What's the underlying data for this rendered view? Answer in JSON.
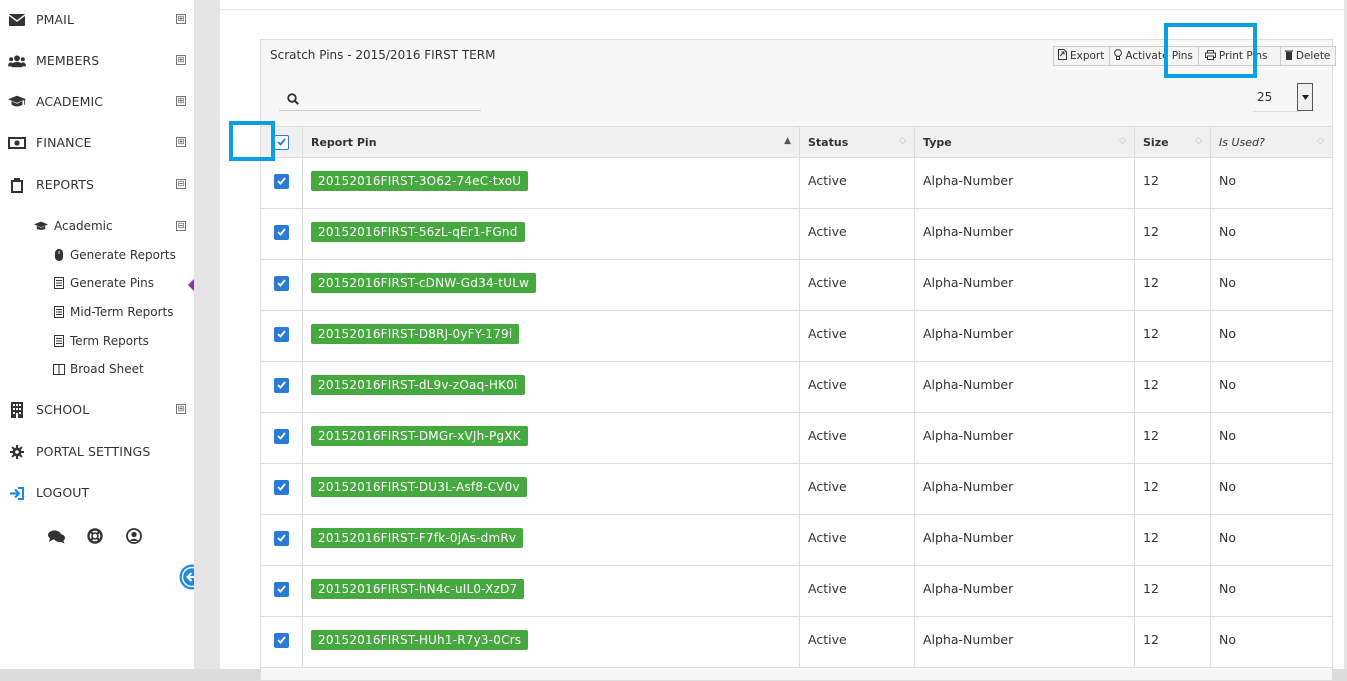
{
  "sidebar": {
    "items": [
      {
        "label": "PMAIL",
        "icon": "envelope-icon",
        "toggle": "⊞"
      },
      {
        "label": "MEMBERS",
        "icon": "users-icon",
        "toggle": "⊞"
      },
      {
        "label": "ACADEMIC",
        "icon": "graduation-cap-icon",
        "toggle": "⊞"
      },
      {
        "label": "FINANCE",
        "icon": "money-icon",
        "toggle": "⊞"
      },
      {
        "label": "REPORTS",
        "icon": "clipboard-icon",
        "toggle": "⊟"
      },
      {
        "label": "SCHOOL",
        "icon": "building-icon",
        "toggle": "⊞"
      },
      {
        "label": "PORTAL SETTINGS",
        "icon": "gear-icon"
      },
      {
        "label": "LOGOUT",
        "icon": "logout-icon"
      }
    ],
    "academic_group": {
      "label": "Academic",
      "toggle": "⊟"
    },
    "sub_items": [
      {
        "label": "Generate Reports"
      },
      {
        "label": "Generate Pins"
      },
      {
        "label": "Mid-Term Reports"
      },
      {
        "label": "Term Reports"
      },
      {
        "label": "Broad Sheet"
      }
    ]
  },
  "panel": {
    "title": "Scratch Pins - 2015/2016 FIRST TERM",
    "buttons": {
      "export": "Export",
      "activate": "Activate Pins",
      "print": "Print Pins",
      "delete": "Delete"
    },
    "search_placeholder": "",
    "page_size": "25"
  },
  "table": {
    "headers": {
      "pin": "Report Pin",
      "status": "Status",
      "type": "Type",
      "size": "Size",
      "used": "Is Used?"
    },
    "rows": [
      {
        "pin": "20152016FIRST-3O62-74eC-txoU",
        "status": "Active",
        "type": "Alpha-Number",
        "size": "12",
        "used": "No"
      },
      {
        "pin": "20152016FIRST-56zL-qEr1-FGnd",
        "status": "Active",
        "type": "Alpha-Number",
        "size": "12",
        "used": "No"
      },
      {
        "pin": "20152016FIRST-cDNW-Gd34-tULw",
        "status": "Active",
        "type": "Alpha-Number",
        "size": "12",
        "used": "No"
      },
      {
        "pin": "20152016FIRST-D8RJ-0yFY-179i",
        "status": "Active",
        "type": "Alpha-Number",
        "size": "12",
        "used": "No"
      },
      {
        "pin": "20152016FIRST-dL9v-zOaq-HK0i",
        "status": "Active",
        "type": "Alpha-Number",
        "size": "12",
        "used": "No"
      },
      {
        "pin": "20152016FIRST-DMGr-xVJh-PgXK",
        "status": "Active",
        "type": "Alpha-Number",
        "size": "12",
        "used": "No"
      },
      {
        "pin": "20152016FIRST-DU3L-Asf8-CV0v",
        "status": "Active",
        "type": "Alpha-Number",
        "size": "12",
        "used": "No"
      },
      {
        "pin": "20152016FIRST-F7fk-0jAs-dmRv",
        "status": "Active",
        "type": "Alpha-Number",
        "size": "12",
        "used": "No"
      },
      {
        "pin": "20152016FIRST-hN4c-uIL0-XzD7",
        "status": "Active",
        "type": "Alpha-Number",
        "size": "12",
        "used": "No"
      },
      {
        "pin": "20152016FIRST-HUh1-R7y3-0Crs",
        "status": "Active",
        "type": "Alpha-Number",
        "size": "12",
        "used": "No"
      }
    ]
  },
  "colors": {
    "accent": "#2a7bd5",
    "badge": "#46a93f",
    "highlight": "#0a9fe2"
  }
}
